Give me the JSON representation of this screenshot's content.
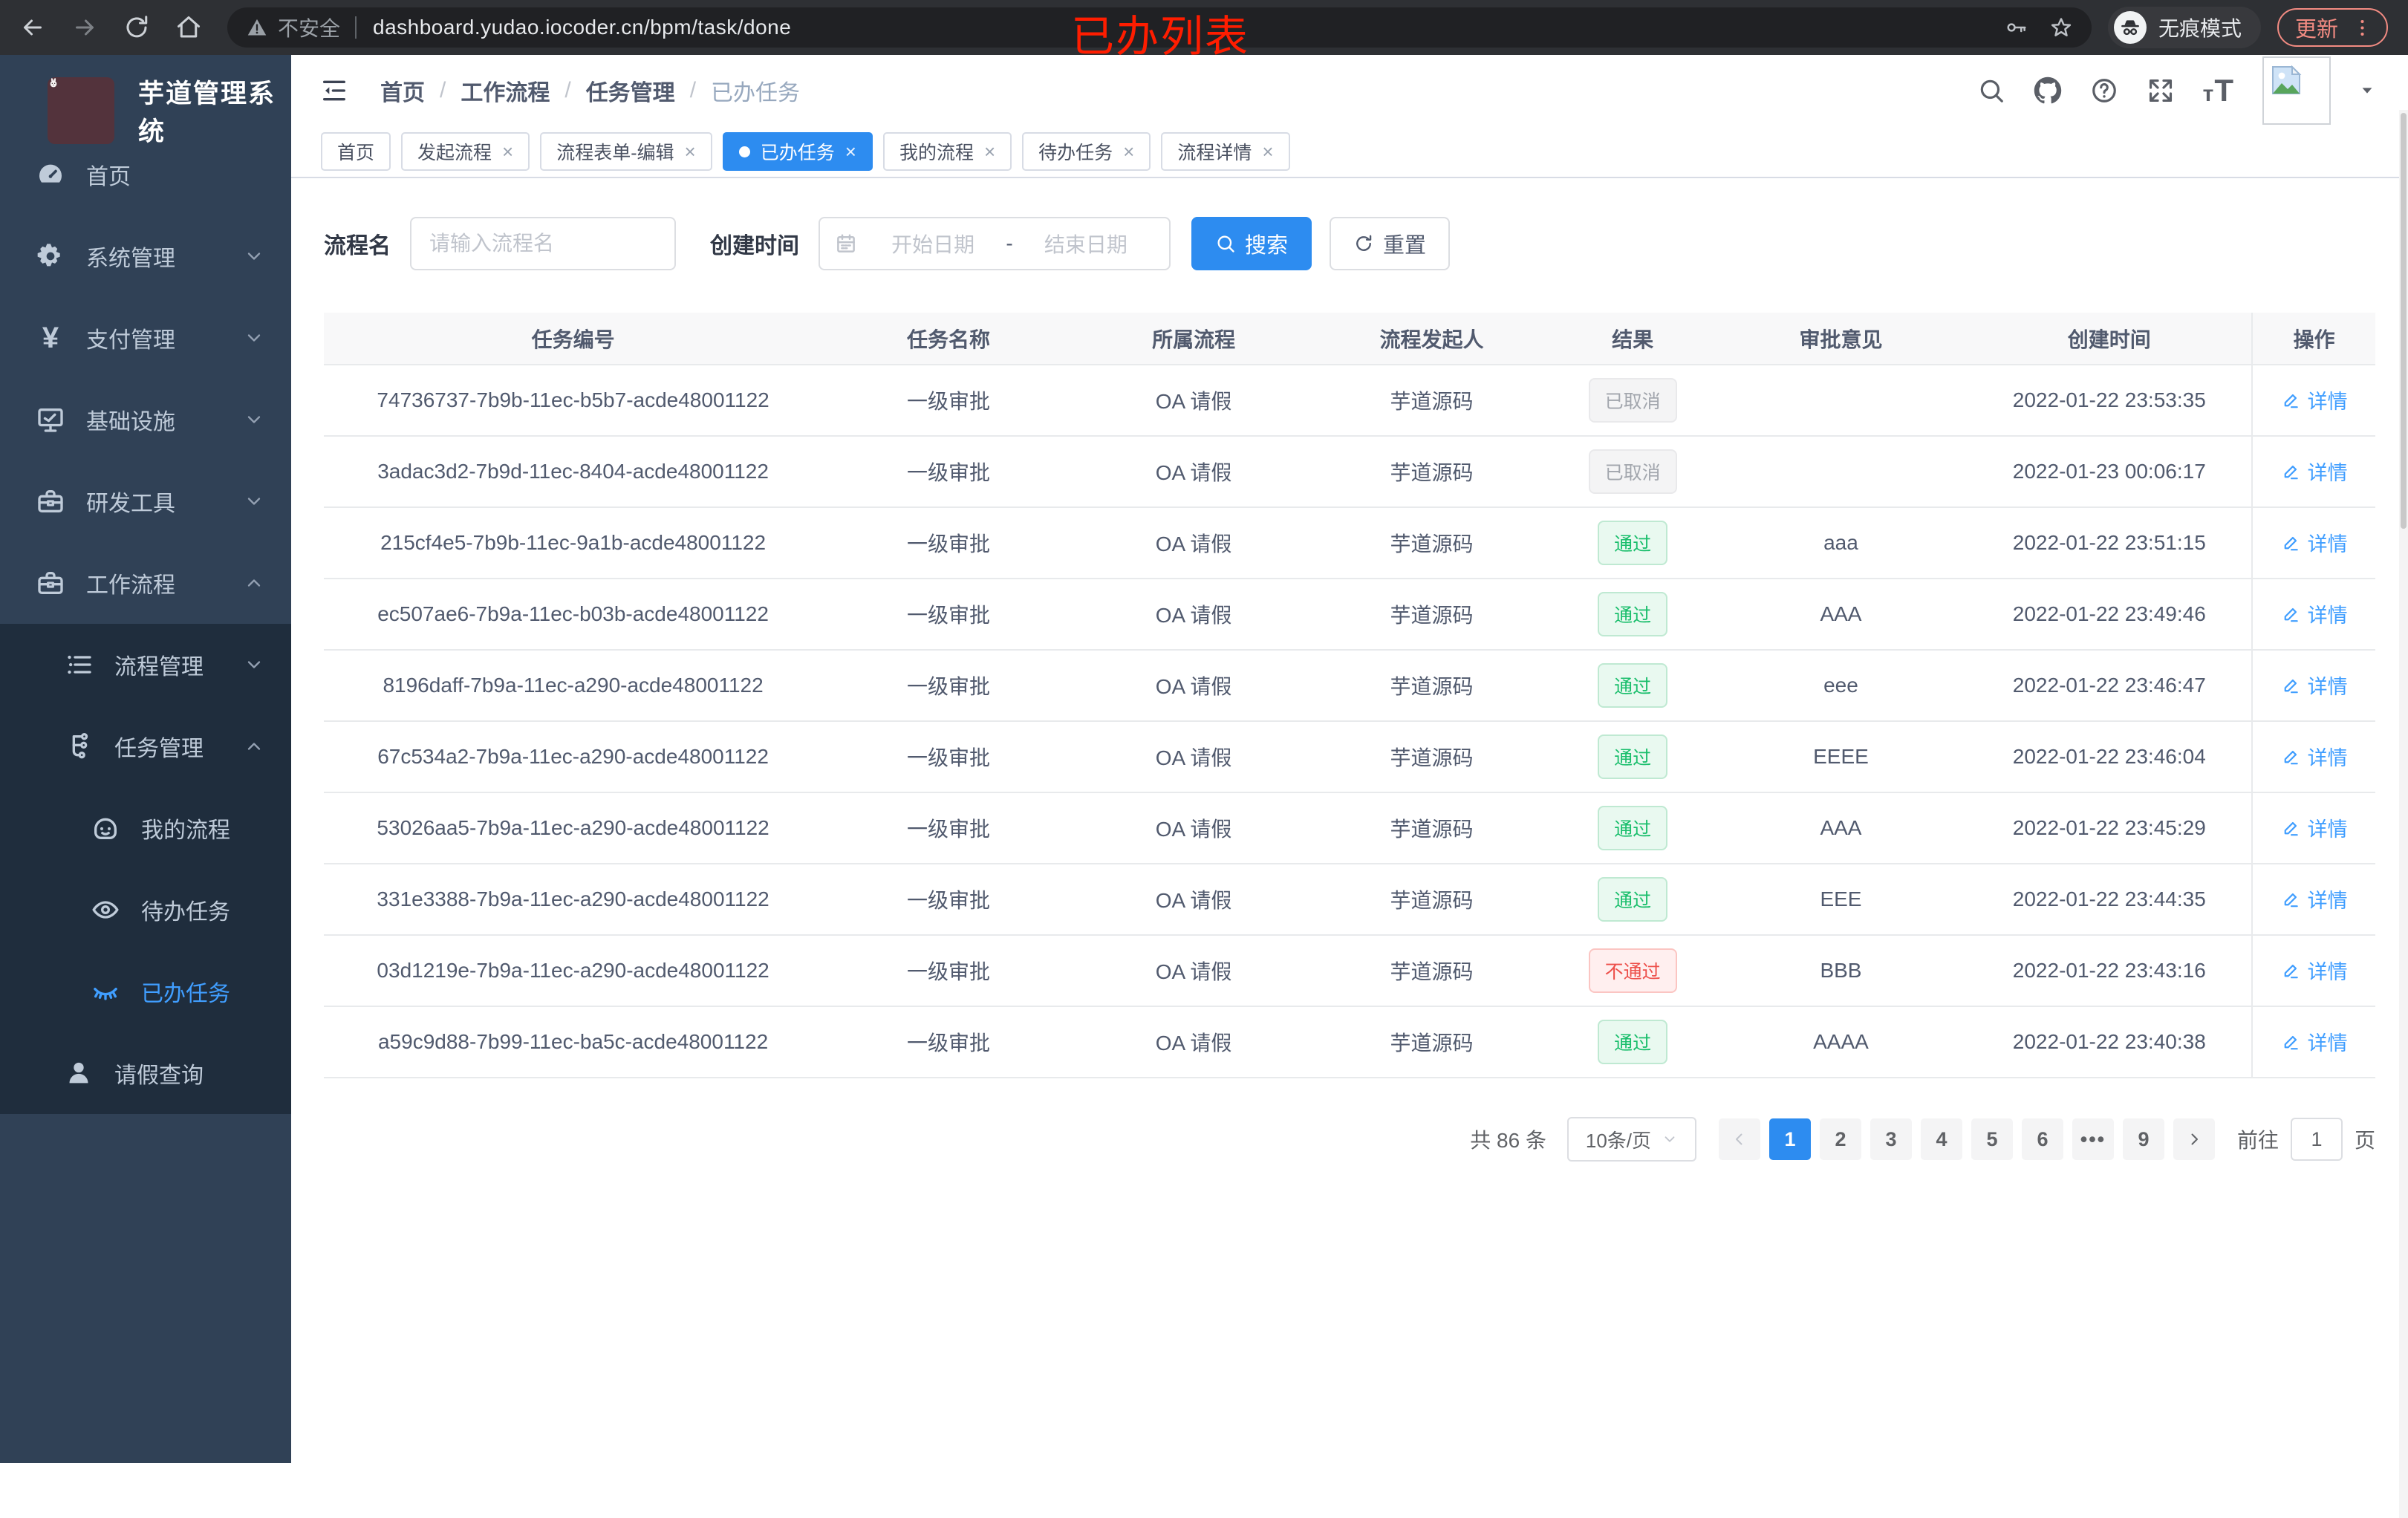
{
  "browser": {
    "security_label": "不安全",
    "url": "dashboard.yudao.iocoder.cn/bpm/task/done",
    "incognito_label": "无痕模式",
    "update_label": "更新"
  },
  "annotation": {
    "text": "已办列表"
  },
  "sidebar": {
    "title": "芋道管理系统",
    "items": [
      {
        "label": "首页",
        "icon": "dashboard-icon",
        "level": 1,
        "chevron": "",
        "sub": false,
        "active": false
      },
      {
        "label": "系统管理",
        "icon": "gear-icon",
        "level": 1,
        "chevron": "down",
        "sub": false,
        "active": false
      },
      {
        "label": "支付管理",
        "icon": "yen-icon",
        "level": 1,
        "chevron": "down",
        "sub": false,
        "active": false
      },
      {
        "label": "基础设施",
        "icon": "infra-icon",
        "level": 1,
        "chevron": "down",
        "sub": false,
        "active": false
      },
      {
        "label": "研发工具",
        "icon": "toolbox-icon",
        "level": 1,
        "chevron": "down",
        "sub": false,
        "active": false
      },
      {
        "label": "工作流程",
        "icon": "workflow-icon",
        "level": 1,
        "chevron": "up",
        "sub": false,
        "active": false
      },
      {
        "label": "流程管理",
        "icon": "process-icon",
        "level": 2,
        "chevron": "down",
        "sub": true,
        "active": false
      },
      {
        "label": "任务管理",
        "icon": "task-icon",
        "level": 2,
        "chevron": "up",
        "sub": true,
        "active": false
      },
      {
        "label": "我的流程",
        "icon": "face-icon",
        "level": 3,
        "chevron": "",
        "sub": true,
        "active": false
      },
      {
        "label": "待办任务",
        "icon": "eye-icon",
        "level": 3,
        "chevron": "",
        "sub": true,
        "active": false
      },
      {
        "label": "已办任务",
        "icon": "eye-closed-icon",
        "level": 3,
        "chevron": "",
        "sub": true,
        "active": true
      },
      {
        "label": "请假查询",
        "icon": "user-icon",
        "level": 2,
        "chevron": "",
        "sub": true,
        "active": false
      }
    ]
  },
  "header": {
    "breadcrumb": [
      "首页",
      "工作流程",
      "任务管理",
      "已办任务"
    ]
  },
  "tabs": [
    {
      "label": "首页",
      "closable": false,
      "active": false
    },
    {
      "label": "发起流程",
      "closable": true,
      "active": false
    },
    {
      "label": "流程表单-编辑",
      "closable": true,
      "active": false
    },
    {
      "label": "已办任务",
      "closable": true,
      "active": true
    },
    {
      "label": "我的流程",
      "closable": true,
      "active": false
    },
    {
      "label": "待办任务",
      "closable": true,
      "active": false
    },
    {
      "label": "流程详情",
      "closable": true,
      "active": false
    }
  ],
  "filter": {
    "name_label": "流程名",
    "name_placeholder": "请输入流程名",
    "time_label": "创建时间",
    "start_placeholder": "开始日期",
    "range_separator": "-",
    "end_placeholder": "结束日期",
    "search_label": "搜索",
    "reset_label": "重置"
  },
  "table": {
    "columns": [
      "任务编号",
      "任务名称",
      "所属流程",
      "流程发起人",
      "结果",
      "审批意见",
      "创建时间",
      "操作"
    ],
    "action_label": "详情",
    "results": {
      "pass": "通过",
      "fail": "不通过",
      "cancel": "已取消"
    },
    "rows": [
      {
        "id": "74736737-7b9b-11ec-b5b7-acde48001122",
        "name": "一级审批",
        "process": "OA 请假",
        "initiator": "芋道源码",
        "result": "cancel",
        "comment": "",
        "time": "2022-01-22 23:53:35"
      },
      {
        "id": "3adac3d2-7b9d-11ec-8404-acde48001122",
        "name": "一级审批",
        "process": "OA 请假",
        "initiator": "芋道源码",
        "result": "cancel",
        "comment": "",
        "time": "2022-01-23 00:06:17"
      },
      {
        "id": "215cf4e5-7b9b-11ec-9a1b-acde48001122",
        "name": "一级审批",
        "process": "OA 请假",
        "initiator": "芋道源码",
        "result": "pass",
        "comment": "aaa",
        "time": "2022-01-22 23:51:15"
      },
      {
        "id": "ec507ae6-7b9a-11ec-b03b-acde48001122",
        "name": "一级审批",
        "process": "OA 请假",
        "initiator": "芋道源码",
        "result": "pass",
        "comment": "AAA",
        "time": "2022-01-22 23:49:46"
      },
      {
        "id": "8196daff-7b9a-11ec-a290-acde48001122",
        "name": "一级审批",
        "process": "OA 请假",
        "initiator": "芋道源码",
        "result": "pass",
        "comment": "eee",
        "time": "2022-01-22 23:46:47"
      },
      {
        "id": "67c534a2-7b9a-11ec-a290-acde48001122",
        "name": "一级审批",
        "process": "OA 请假",
        "initiator": "芋道源码",
        "result": "pass",
        "comment": "EEEE",
        "time": "2022-01-22 23:46:04"
      },
      {
        "id": "53026aa5-7b9a-11ec-a290-acde48001122",
        "name": "一级审批",
        "process": "OA 请假",
        "initiator": "芋道源码",
        "result": "pass",
        "comment": "AAA",
        "time": "2022-01-22 23:45:29"
      },
      {
        "id": "331e3388-7b9a-11ec-a290-acde48001122",
        "name": "一级审批",
        "process": "OA 请假",
        "initiator": "芋道源码",
        "result": "pass",
        "comment": "EEE",
        "time": "2022-01-22 23:44:35"
      },
      {
        "id": "03d1219e-7b9a-11ec-a290-acde48001122",
        "name": "一级审批",
        "process": "OA 请假",
        "initiator": "芋道源码",
        "result": "fail",
        "comment": "BBB",
        "time": "2022-01-22 23:43:16"
      },
      {
        "id": "a59c9d88-7b99-11ec-ba5c-acde48001122",
        "name": "一级审批",
        "process": "OA 请假",
        "initiator": "芋道源码",
        "result": "pass",
        "comment": "AAAA",
        "time": "2022-01-22 23:40:38"
      }
    ]
  },
  "pagination": {
    "total_label": "共 86 条",
    "page_size_label": "10条/页",
    "pages": [
      "1",
      "2",
      "3",
      "4",
      "5",
      "6",
      "...",
      "9"
    ],
    "active_page": "1",
    "goto_label": "前往",
    "goto_value": "1",
    "page_unit": "页"
  },
  "colors": {
    "accent": "#2d8cf0",
    "link": "#409eff",
    "sidebar_bg": "#304156",
    "submenu_bg": "#1f2d3d",
    "sidebar_active": "#409eff",
    "pass_green": "#19be6b",
    "fail_red": "#ed4f4a",
    "cancel_gray": "#a2a6ad",
    "annotation_red": "#ff1d00",
    "update_red": "#f28b82"
  }
}
